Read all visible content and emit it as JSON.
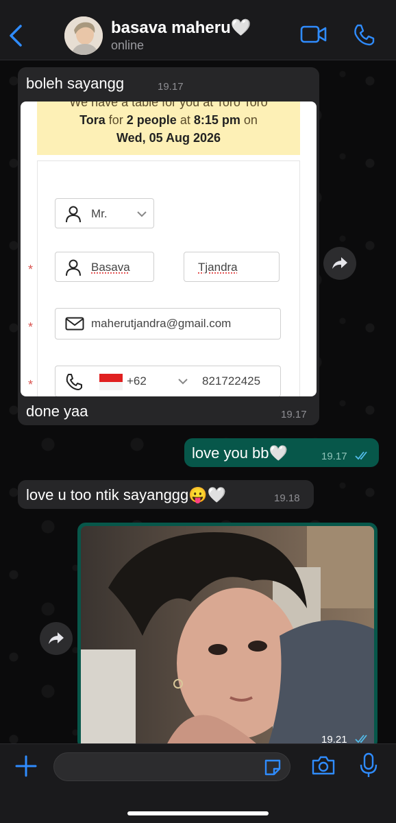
{
  "header": {
    "contact_name": "basava maheru🤍",
    "status": "online"
  },
  "messages": {
    "m1": {
      "text": "boleh sayangg",
      "time": "19.17"
    },
    "m2": {
      "text": "done yaa",
      "time": "19.17"
    },
    "m3": {
      "text": "love you bb🤍",
      "time": "19.17"
    },
    "m4": {
      "text": "love u too ntik sayanggg😛🤍",
      "time": "19.18"
    },
    "m5": {
      "time": "19.21"
    }
  },
  "booking_screenshot": {
    "banner_top": "We have a table for you at Toro Toro",
    "banner_restaurant": "Tora",
    "banner_for": "for",
    "banner_people": "2 people",
    "banner_at": "at",
    "banner_time": "8:15 pm",
    "banner_on": "on",
    "banner_date": "Wed, 05 Aug 2026",
    "title_select": "Mr.",
    "first_name": "Basava",
    "last_name": "Tjandra",
    "email": "maherutjandra@gmail.com",
    "country_code": "+62",
    "phone": "821722425",
    "required_mark": "*"
  },
  "composer": {
    "placeholder": ""
  },
  "colors": {
    "accent": "#2f8cff",
    "incoming_bubble": "#262628",
    "outgoing_bubble": "#07574a",
    "read_ticks": "#53bdeb"
  },
  "icons": [
    "chevron-left-icon",
    "video-call-icon",
    "phone-icon",
    "forward-icon",
    "plus-icon",
    "sticker-icon",
    "camera-icon",
    "microphone-icon",
    "person-icon",
    "mail-icon",
    "read-ticks-icon"
  ]
}
